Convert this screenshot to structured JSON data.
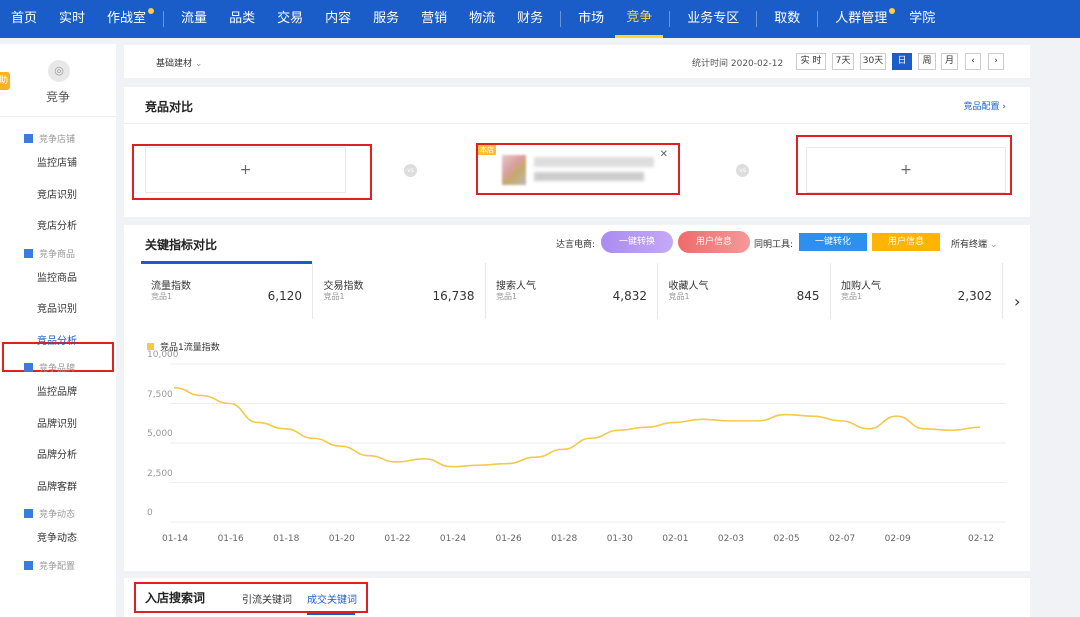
{
  "topnav": {
    "items": [
      {
        "label": "首页",
        "dot": false,
        "active": false
      },
      {
        "label": "实时",
        "dot": false,
        "active": false
      },
      {
        "label": "作战室",
        "dot": true,
        "active": false
      },
      {
        "label": "流量",
        "dot": false,
        "active": false
      },
      {
        "label": "品类",
        "dot": false,
        "active": false
      },
      {
        "label": "交易",
        "dot": false,
        "active": false
      },
      {
        "label": "内容",
        "dot": false,
        "active": false
      },
      {
        "label": "服务",
        "dot": false,
        "active": false
      },
      {
        "label": "营销",
        "dot": false,
        "active": false
      },
      {
        "label": "物流",
        "dot": false,
        "active": false
      },
      {
        "label": "财务",
        "dot": false,
        "active": false
      },
      {
        "label": "市场",
        "dot": false,
        "active": false
      },
      {
        "label": "竞争",
        "dot": false,
        "active": true
      },
      {
        "label": "业务专区",
        "dot": false,
        "active": false
      },
      {
        "label": "取数",
        "dot": false,
        "active": false
      },
      {
        "label": "人群管理",
        "dot": true,
        "active": false
      },
      {
        "label": "学院",
        "dot": false,
        "active": false
      }
    ]
  },
  "sidebar": {
    "badge": "助",
    "title": "竞争",
    "groups": [
      {
        "label": "竞争店铺",
        "items": [
          "监控店铺",
          "竞店识别",
          "竞店分析"
        ]
      },
      {
        "label": "竞争商品",
        "items": [
          "监控商品",
          "竞品识别",
          "竞品分析"
        ]
      },
      {
        "label": "竞争品牌",
        "items": [
          "监控品牌",
          "品牌识别",
          "品牌分析",
          "品牌客群"
        ]
      },
      {
        "label": "竞争动态",
        "items": [
          "竞争动态"
        ]
      },
      {
        "label": "竞争配置",
        "items": []
      }
    ]
  },
  "filter": {
    "category": "基础建材",
    "stat_time": "统计时间 2020-02-12",
    "buttons": [
      "实 时",
      "7天",
      "30天",
      "日",
      "周",
      "月"
    ],
    "active_button": "日"
  },
  "compare": {
    "title": "竞品对比",
    "config_link": "竞品配置",
    "add_symbol": "+",
    "vs": "vs",
    "product_tag": "本店",
    "close_symbol": "✕"
  },
  "metrics": {
    "title": "关键指标对比",
    "dazhi_label": "达言电商:",
    "btn_convert": "一键转换",
    "btn_user_info": "用户信息",
    "tongming_label": "同明工具:",
    "btn_convert2": "一键转化",
    "btn_user_info2": "用户信息",
    "all_terminals": "所有终端",
    "colors": {
      "purple": "#a98cf0",
      "red": "#ef6a6a",
      "blue": "#2d8ff0",
      "orange": "#ffb400",
      "line": "#f2c94c",
      "accent": "#1a5dc8"
    },
    "kpis": [
      {
        "name": "流量指数",
        "sub": "竞品1",
        "value": "6,120",
        "active": true
      },
      {
        "name": "交易指数",
        "sub": "竞品1",
        "value": "16,738",
        "active": false
      },
      {
        "name": "搜索人气",
        "sub": "竞品1",
        "value": "4,832",
        "active": false
      },
      {
        "name": "收藏人气",
        "sub": "竞品1",
        "value": "845",
        "active": false
      },
      {
        "name": "加购人气",
        "sub": "竞品1",
        "value": "2,302",
        "active": false
      }
    ],
    "next_symbol": "›"
  },
  "chart_data": {
    "type": "line",
    "title": "",
    "legend": "竞品1流量指数",
    "legend_placement": "top-left",
    "ylim": [
      0,
      10000
    ],
    "yticks": [
      "0",
      "2,500",
      "5,000",
      "7,500",
      "10,000"
    ],
    "xtick_labels": [
      "01-14",
      "01-16",
      "01-18",
      "01-20",
      "01-22",
      "01-24",
      "01-26",
      "01-28",
      "01-30",
      "02-01",
      "02-03",
      "02-05",
      "02-07",
      "02-09",
      "02-12"
    ],
    "x": [
      "01-14",
      "01-15",
      "01-16",
      "01-17",
      "01-18",
      "01-19",
      "01-20",
      "01-21",
      "01-22",
      "01-23",
      "01-24",
      "01-25",
      "01-26",
      "01-27",
      "01-28",
      "01-29",
      "01-30",
      "01-31",
      "02-01",
      "02-02",
      "02-03",
      "02-04",
      "02-05",
      "02-06",
      "02-07",
      "02-08",
      "02-09",
      "02-10",
      "02-11",
      "02-12"
    ],
    "series": [
      {
        "name": "竞品1流量指数",
        "values": [
          8500,
          8000,
          7500,
          6300,
          5900,
          5300,
          4800,
          4200,
          3800,
          4000,
          3500,
          3600,
          3700,
          4100,
          4600,
          5300,
          5800,
          6000,
          6300,
          6500,
          6400,
          6400,
          6800,
          6700,
          6400,
          5900,
          6700,
          5900,
          5800,
          6000
        ]
      }
    ],
    "grid": true
  },
  "search": {
    "title": "入店搜索词",
    "tabs": [
      "引流关键词",
      "成交关键词"
    ],
    "active_tab": "成交关键词"
  }
}
